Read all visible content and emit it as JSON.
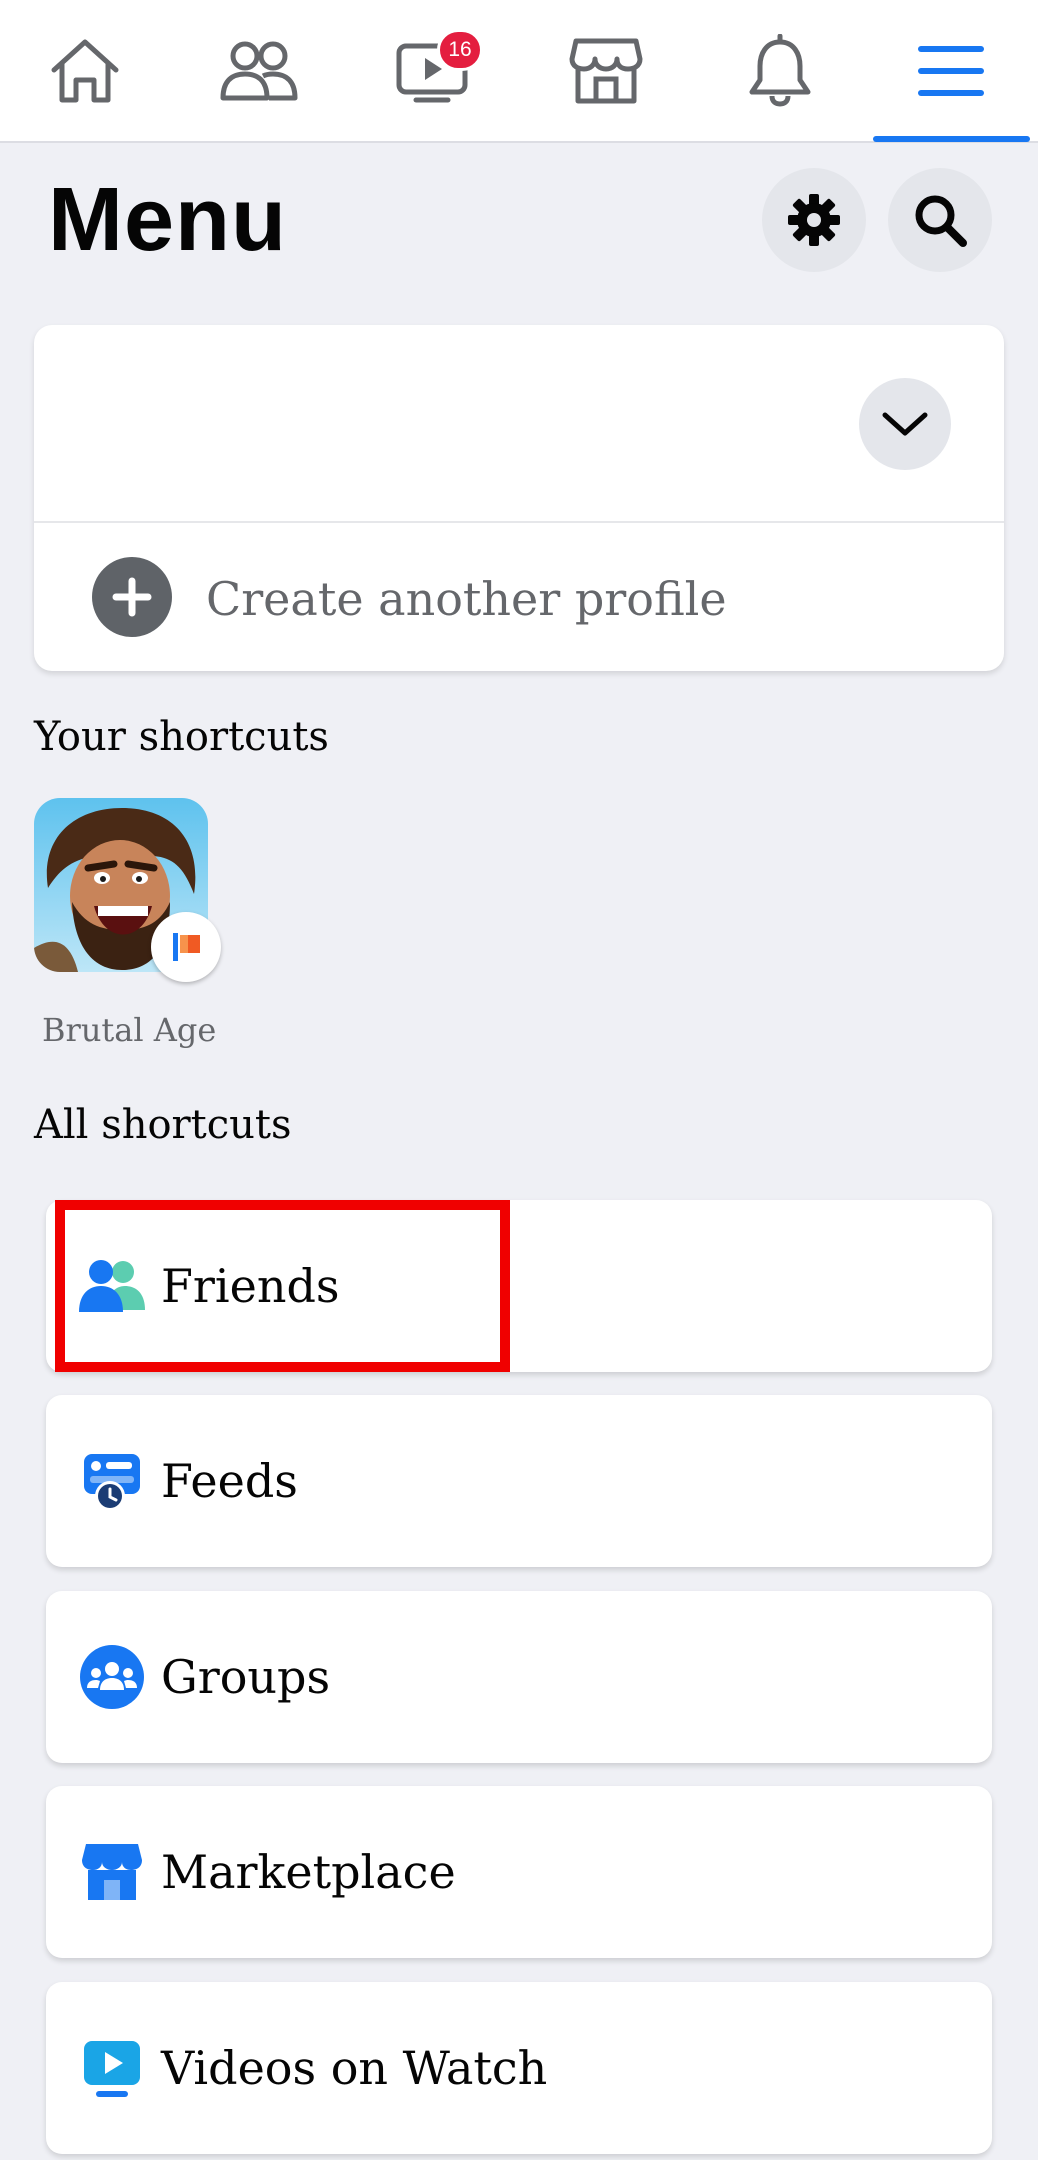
{
  "nav": {
    "tabs": [
      {
        "name": "home",
        "icon": "home-icon"
      },
      {
        "name": "friends",
        "icon": "friends-icon"
      },
      {
        "name": "watch",
        "icon": "video-icon",
        "badge": "16"
      },
      {
        "name": "marketplace",
        "icon": "marketplace-icon"
      },
      {
        "name": "notifications",
        "icon": "bell-icon"
      },
      {
        "name": "menu",
        "icon": "hamburger-icon",
        "active": true
      }
    ],
    "watch_badge": "16",
    "accent_color": "#1877f2"
  },
  "header": {
    "title": "Menu",
    "settings_icon": "gear-icon",
    "search_icon": "search-icon"
  },
  "profile": {
    "chevron_icon": "chevron-down-icon",
    "create_label": "Create another profile",
    "create_icon": "plus-icon"
  },
  "your_shortcuts": {
    "heading": "Your shortcuts",
    "items": [
      {
        "label": "Brutal Age",
        "icon": "game-app-icon",
        "badge_icon": "flag-icon"
      }
    ]
  },
  "all_shortcuts": {
    "heading": "All shortcuts",
    "items": [
      {
        "label": "Friends",
        "icon": "friends-icon",
        "highlighted": true
      },
      {
        "label": "Feeds",
        "icon": "feeds-icon"
      },
      {
        "label": "Groups",
        "icon": "groups-icon"
      },
      {
        "label": "Marketplace",
        "icon": "marketplace-icon"
      },
      {
        "label": "Videos on Watch",
        "icon": "video-icon"
      }
    ]
  },
  "highlight_color": "#f00000"
}
